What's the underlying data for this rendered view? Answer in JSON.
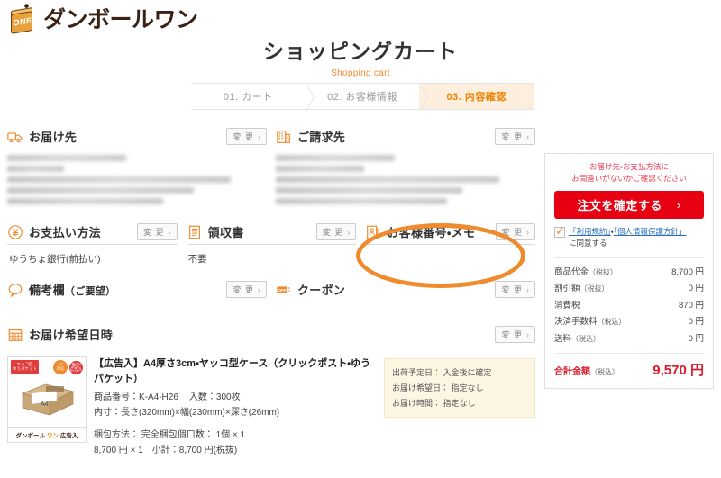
{
  "brand": {
    "name": "ダンボールワン",
    "cube_text": "ONE"
  },
  "header": {
    "title": "ショッピングカート",
    "subtitle": "Shopping cart"
  },
  "steps": [
    {
      "label": "01. カート",
      "state": "done"
    },
    {
      "label": "02. お客様情報",
      "state": "done"
    },
    {
      "label": "03. 内容確認",
      "state": "active"
    }
  ],
  "change_button": {
    "label": "変 更",
    "chevron": "›"
  },
  "sections": {
    "shipping_address": {
      "title": "お届け先",
      "icon": "truck-icon",
      "redacted": true
    },
    "billing_address": {
      "title": "ご請求先",
      "icon": "building-icon",
      "redacted": true
    },
    "payment_method": {
      "title": "お支払い方法",
      "icon": "yen-circle-icon",
      "value": "ゆうちょ銀行(前払い)"
    },
    "receipt": {
      "title": "領収書",
      "icon": "receipt-icon",
      "value": "不要"
    },
    "customer_memo": {
      "title": "お客様番号・メモ",
      "icon": "contact-card-icon",
      "value": ""
    },
    "remarks": {
      "title": "備考欄",
      "title_suffix": "（ご要望）",
      "icon": "speech-bubble-icon",
      "value": ""
    },
    "coupon": {
      "title": "クーポン",
      "icon": "off-tag-icon",
      "badge_text": "OFF",
      "value": ""
    },
    "delivery_datetime": {
      "title": "お届け希望日時",
      "icon": "calendar-icon"
    }
  },
  "product": {
    "name": "【広告入】A4厚さ3cm・ヤッコ型ケース（クリックポスト・ゆうパケット）",
    "code_label": "商品番号：",
    "code": "K-A4-H26",
    "qty_label": "入数：",
    "qty": "300枚",
    "size_label": "内寸：",
    "size": "長さ(320mm)×幅(230mm)×深さ(26mm)",
    "pack_label": "梱包方法：",
    "pack": "完全梱包",
    "boxes_label": "個口数：",
    "boxes": "1個 × 1",
    "price_line": "8,700 円 × 1　小計：8,700 円(税抜)",
    "thumb": {
      "badge": "ヤッコ型ケース\nゆうパケット",
      "pill_a4": "A4\n対応",
      "pill_ad": "激安!\n広告入",
      "foot_brand": "ダンボール",
      "foot_one": "ワン",
      "foot_tail": "広告入",
      "dim_left": "230",
      "dim_bottom": "320",
      "dim_right": "26",
      "label_a4": "A4"
    },
    "shipping_info": [
      {
        "label": "出荷予定日：",
        "value": "入金後に確定"
      },
      {
        "label": "お届け希望日：",
        "value": "指定なし"
      },
      {
        "label": "お届け時間：",
        "value": "指定なし"
      }
    ]
  },
  "sidebar": {
    "warning_line1": "お届け先・お支払方法に",
    "warning_line2": "お間違いがないかご確認ください",
    "order_button": "注文を確定する",
    "order_chevron": "›",
    "agree": {
      "terms_link": "「利用規約」",
      "separator": "・",
      "privacy_link": "「個人情報保護方針」",
      "suffix": "に同意する"
    },
    "summary": [
      {
        "label": "商品代金",
        "tax": "（税抜）",
        "value": "8,700 円"
      },
      {
        "label": "割引額",
        "tax": "（税抜）",
        "value": "0 円"
      },
      {
        "label": "消費税",
        "tax": "",
        "value": "870 円"
      },
      {
        "label": "決済手数料",
        "tax": "（税込）",
        "value": "0 円"
      },
      {
        "label": "送料",
        "tax": "（税込）",
        "value": "0 円"
      }
    ],
    "total": {
      "label": "合計金額",
      "tax": "（税込）",
      "value": "9,570 円"
    }
  },
  "colors": {
    "brand_orange": "#ef8200",
    "order_red": "#e60012",
    "total_red": "#d81a2b",
    "warning_red": "#e8384f",
    "link_blue": "#2a6ebb",
    "active_step_bg": "#fdeede",
    "ship_box_bg": "#fdf6e3"
  }
}
